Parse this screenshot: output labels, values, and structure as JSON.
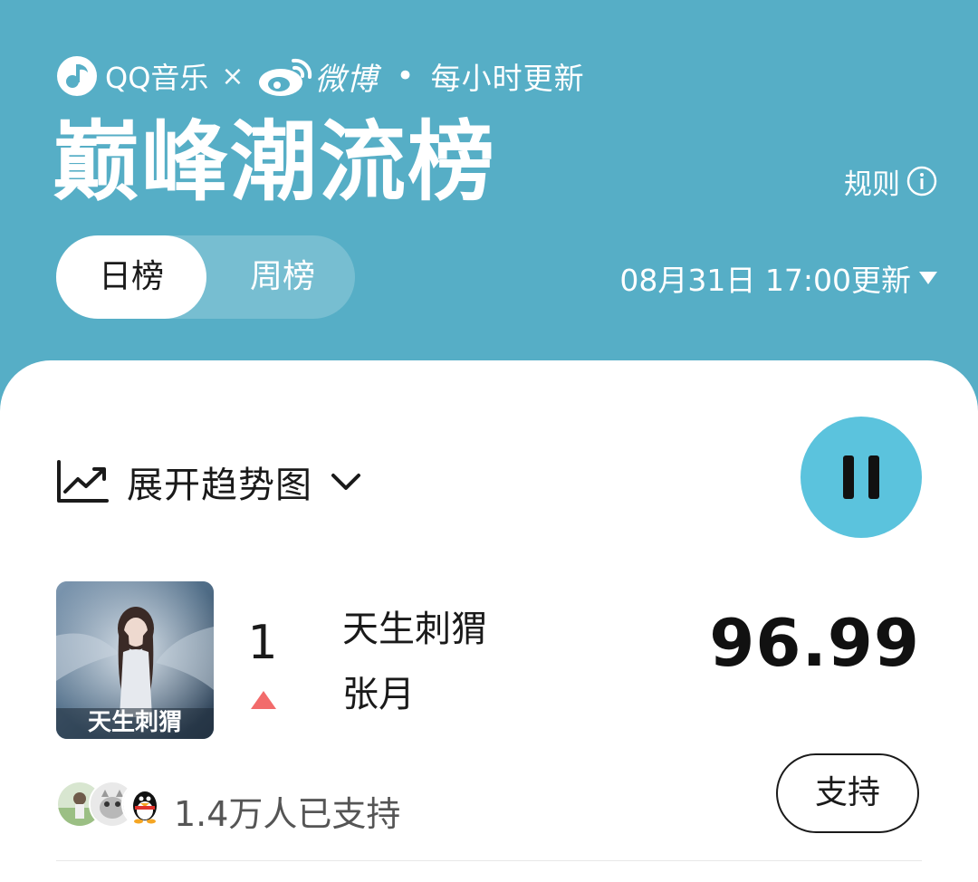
{
  "header": {
    "brand_qq": "QQ音乐",
    "brand_times": "×",
    "brand_weibo": "微博",
    "brand_dot": "•",
    "update_frequency": "每小时更新",
    "title": "巅峰潮流榜",
    "rules_label": "规则",
    "tabs": [
      {
        "label": "日榜",
        "active": true
      },
      {
        "label": "周榜",
        "active": false
      }
    ],
    "update_time": "08月31日 17:00更新"
  },
  "toolbar": {
    "trend_label": "展开趋势图"
  },
  "song": {
    "rank": "1",
    "rank_change": "up",
    "title": "天生刺猬",
    "artist": "张月",
    "score": "96.99",
    "cover_text": "天生刺猬"
  },
  "support": {
    "count_text": "1.4万人已支持",
    "button_label": "支持"
  },
  "colors": {
    "header_bg": "#56AEC6",
    "play_button": "#5BC3DD",
    "rank_up": "#F26B6B",
    "text_primary": "#1A1A1A",
    "text_secondary": "#555555"
  },
  "icons": [
    "qq-music-logo",
    "weibo-logo",
    "info-icon",
    "caret-down-icon",
    "trend-chart-icon",
    "chevron-down-icon",
    "pause-icon",
    "rank-up-icon"
  ]
}
